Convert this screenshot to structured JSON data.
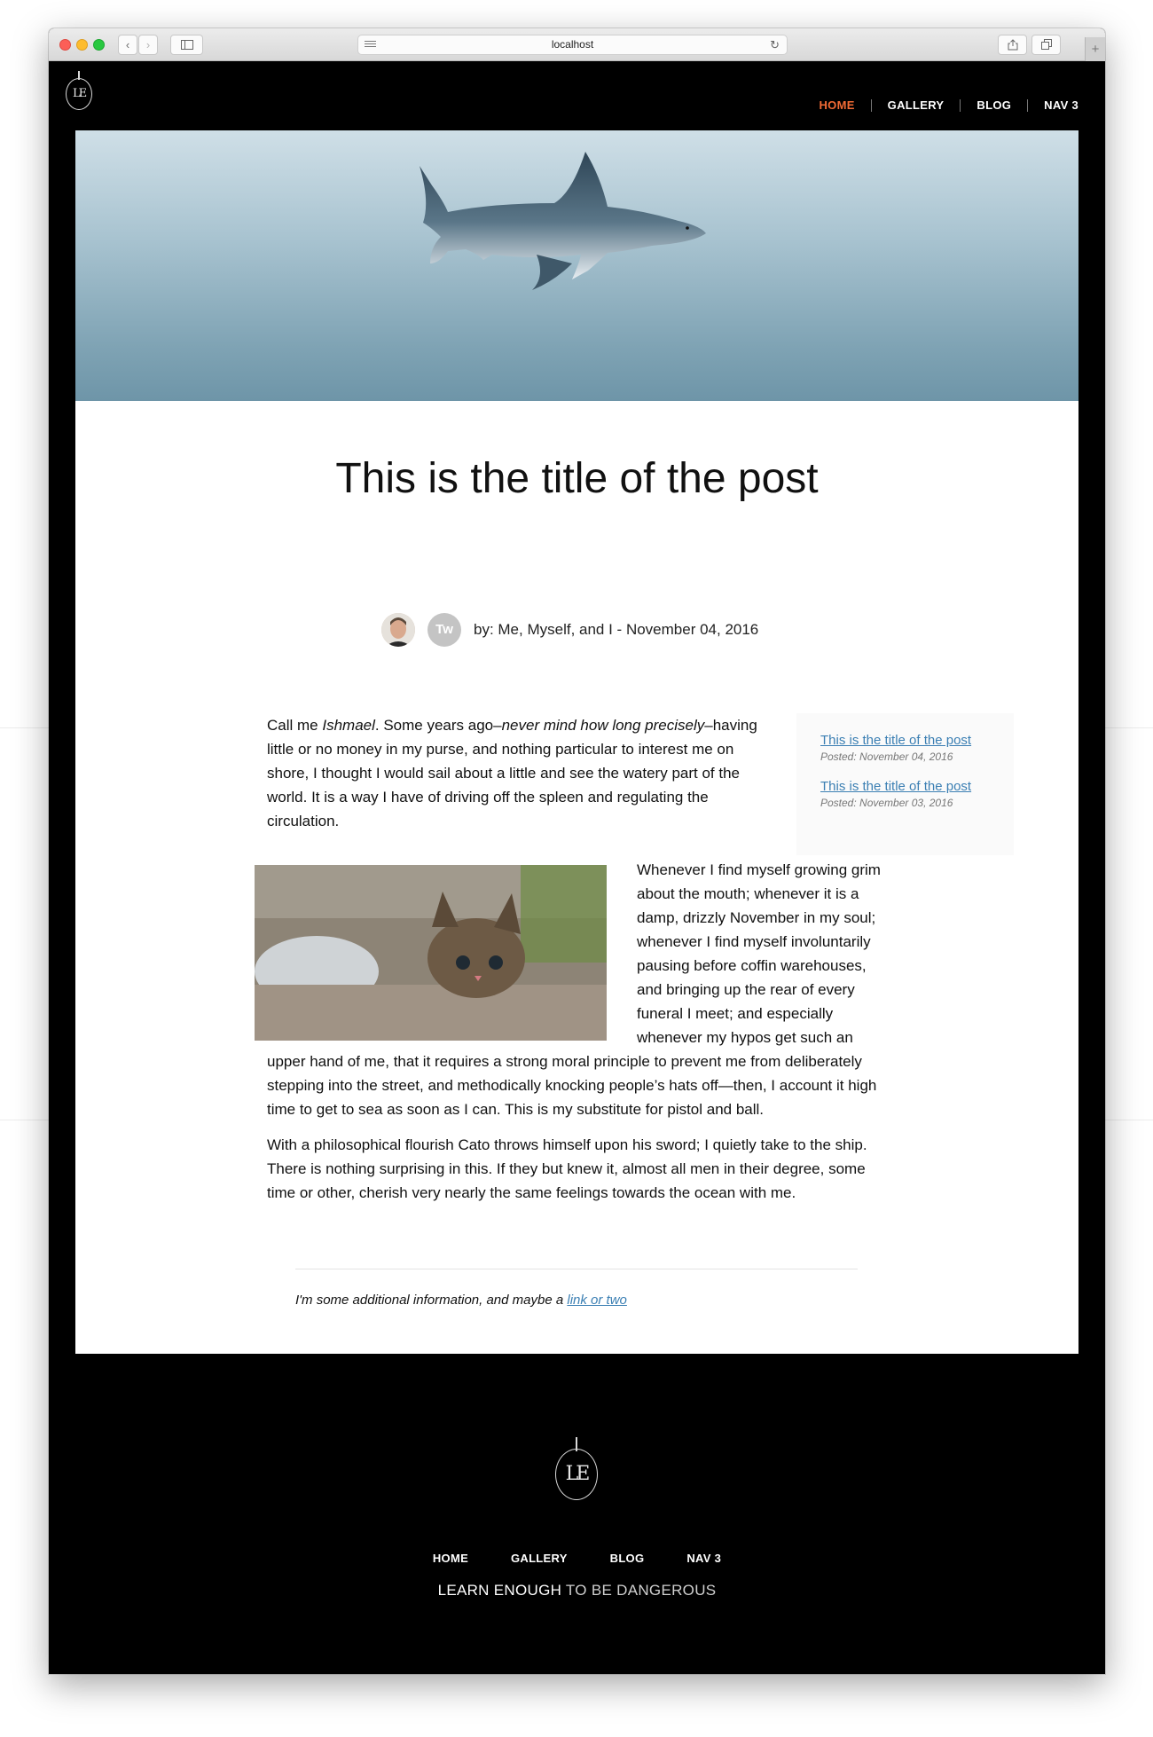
{
  "browser": {
    "url": "localhost",
    "reload_glyph": "↻",
    "back_glyph": "‹",
    "forward_glyph": "›",
    "newtab_glyph": "+"
  },
  "header": {
    "logo_text": "LE",
    "nav": [
      {
        "label": "HOME",
        "active": true
      },
      {
        "label": "GALLERY",
        "active": false
      },
      {
        "label": "BLOG",
        "active": false
      },
      {
        "label": "NAV 3",
        "active": false
      }
    ]
  },
  "post": {
    "title": "This is the title of the post",
    "avatar_initials": "Tw",
    "byline": "by: Me, Myself, and I - November 04, 2016",
    "p1_a": "Call me ",
    "p1_em1": "Ishmael",
    "p1_b": ". Some years ago–",
    "p1_em2": "never mind how long precisely",
    "p1_c": "–having little or no money in my purse, and nothing particular to interest me on shore, I thought I would sail about a little and see the watery part of the world. It is a way I have of driving off the spleen and regulating the circulation.",
    "p2": "Whenever I find myself growing grim about the mouth; whenever it is a damp, drizzly November in my soul; whenever I find myself involuntarily pausing before coffin warehouses, and bringing up the rear of every funeral I meet; and especially whenever my hypos get such an upper hand of me, that it requires a strong moral principle to prevent me from deliberately stepping into the street, and methodically knocking people’s hats off—then, I account it high time to get to sea as soon as I can. This is my substitute for pistol and ball.",
    "p3": "With a philosophical flourish Cato throws himself upon his sword; I quietly take to the ship. There is nothing surprising in this. If they but knew it, almost all men in their degree, some time or other, cherish very nearly the same feelings towards the ocean with me.",
    "extra_text": "I'm some additional information, and maybe a ",
    "extra_link": "link or two"
  },
  "sidebar": {
    "items": [
      {
        "title": "This is the title of the post",
        "date": "Posted: November 04, 2016"
      },
      {
        "title": "This is the title of the post",
        "date": "Posted: November 03, 2016"
      }
    ]
  },
  "footer": {
    "logo_text": "LE",
    "nav": [
      "HOME",
      "GALLERY",
      "BLOG",
      "NAV 3"
    ],
    "tagline_bold": "LEARN ENOUGH",
    "tagline_rest": " TO BE DANGEROUS"
  },
  "colors": {
    "accent": "#f26b35",
    "link": "#3b7fb3",
    "background": "#000000"
  }
}
